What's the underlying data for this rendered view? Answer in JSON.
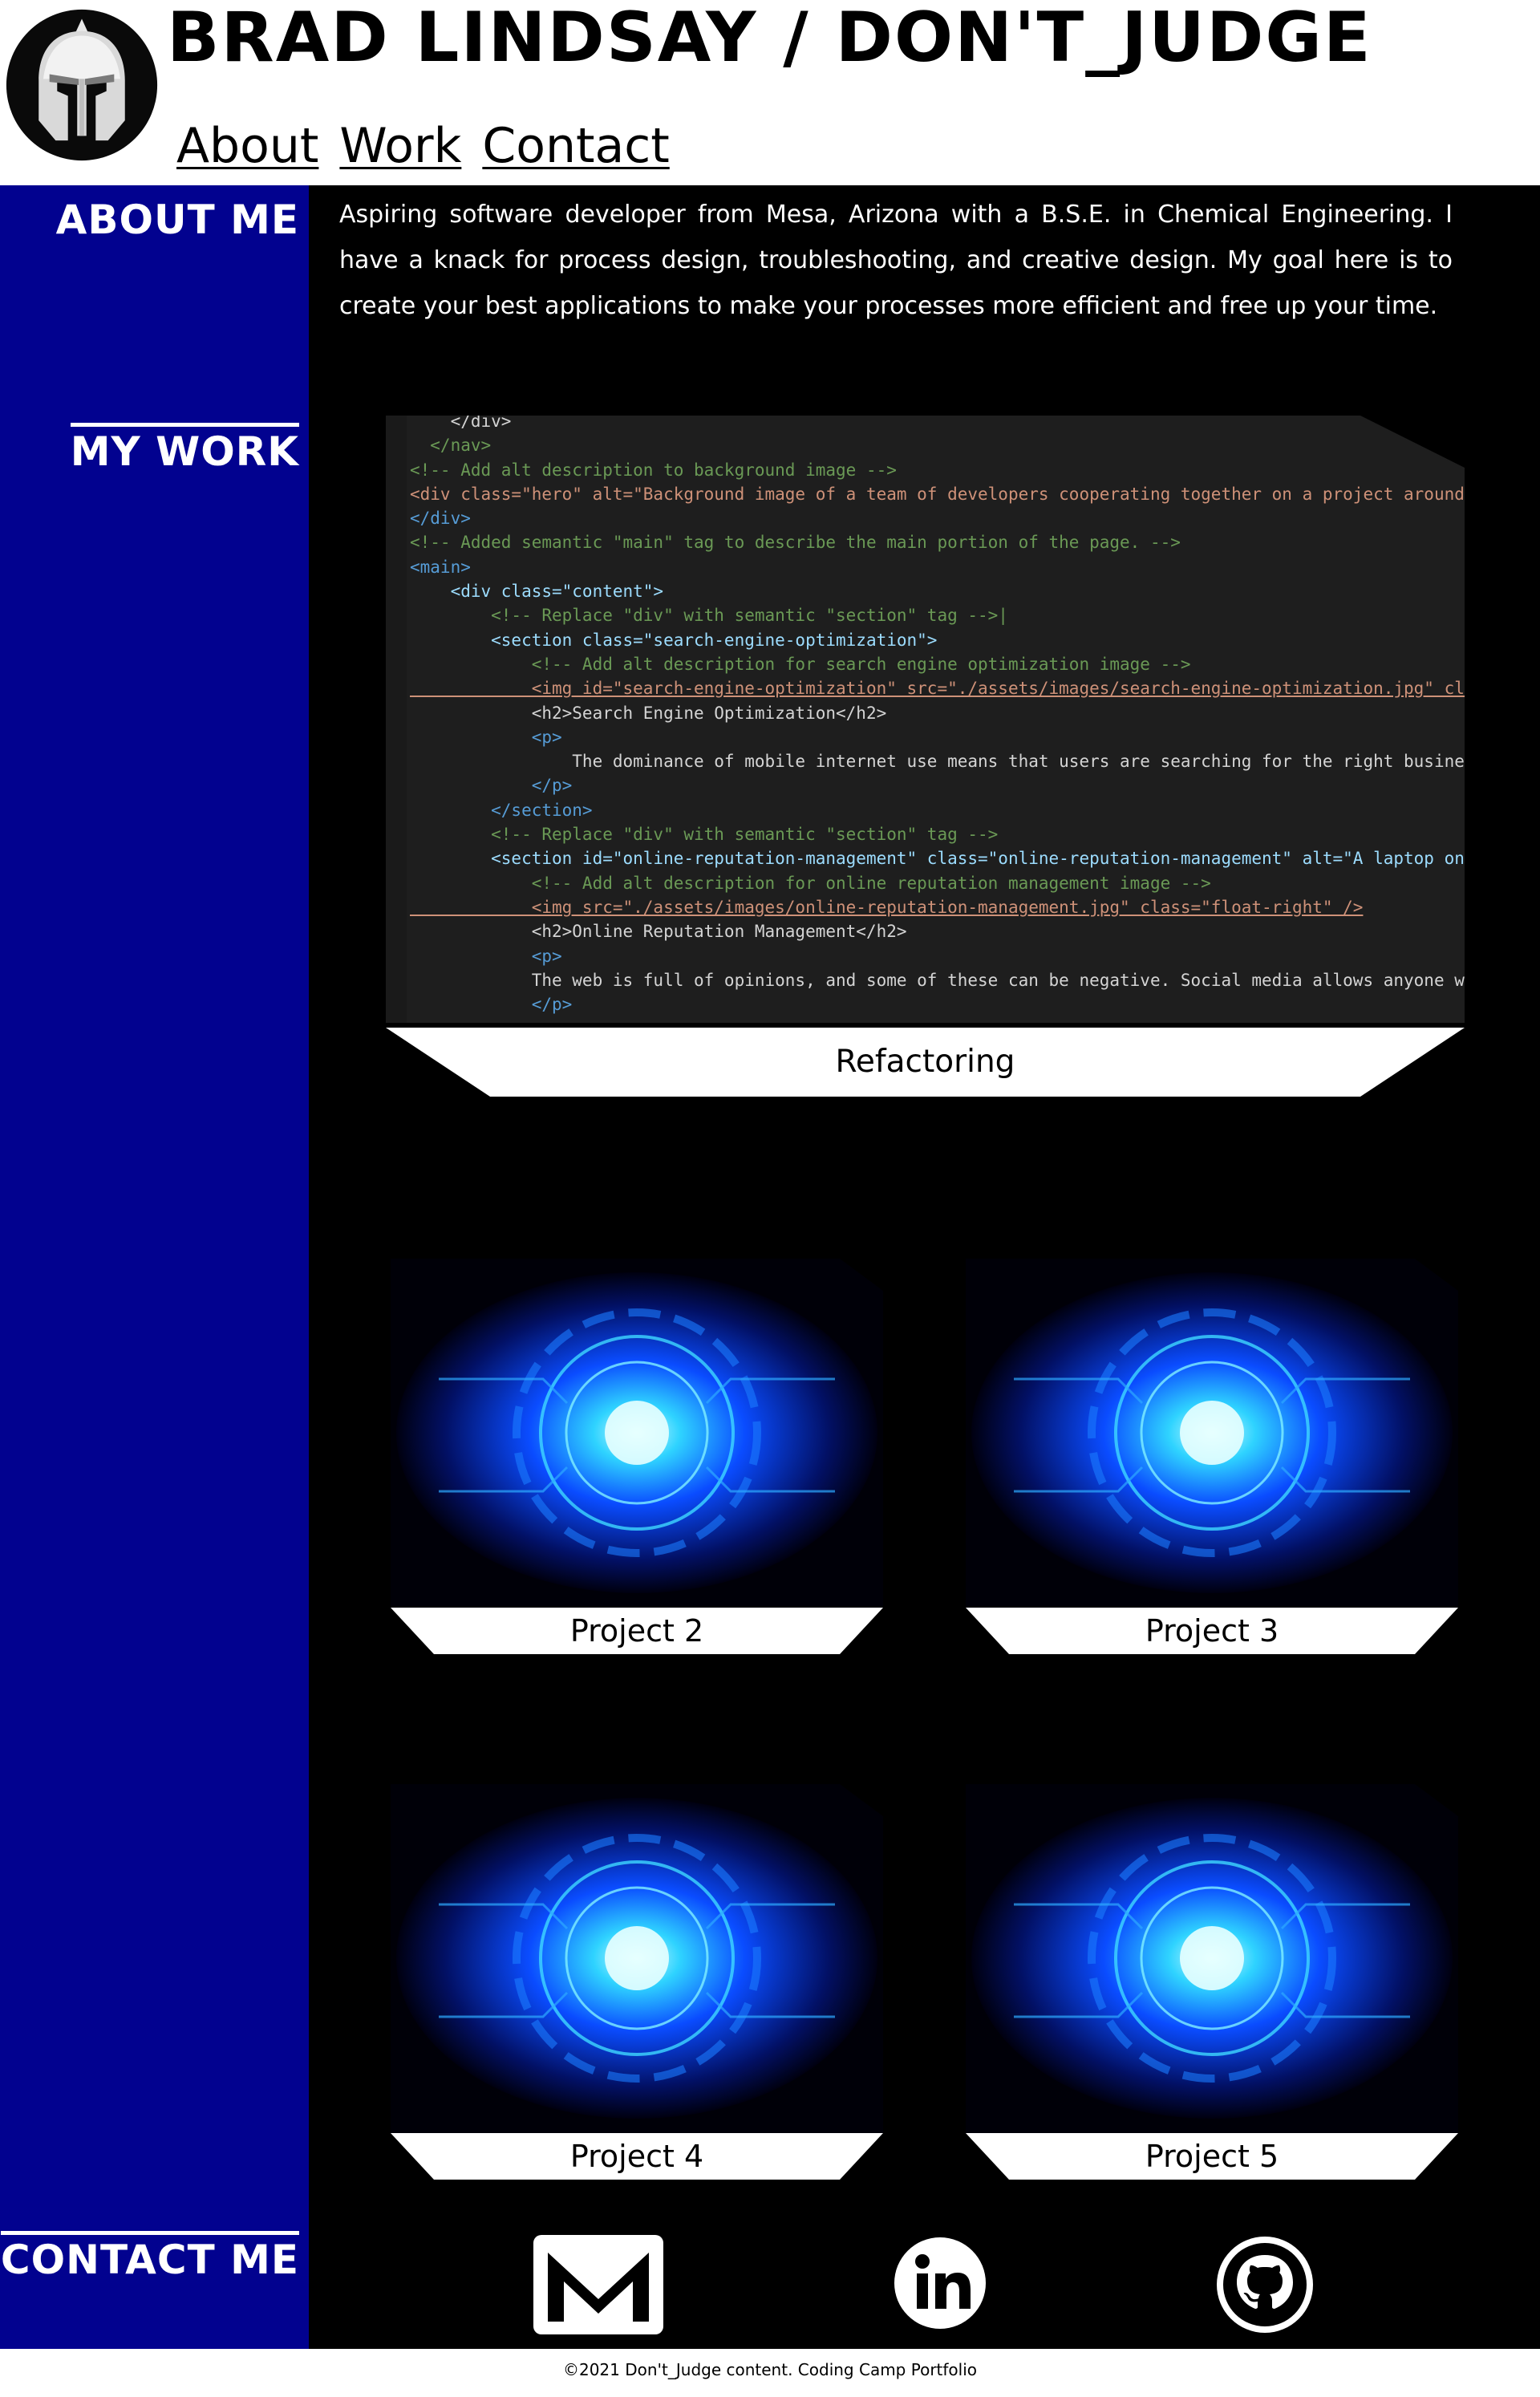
{
  "header": {
    "title": "BRAD LINDSAY / DON'T_JUDGE",
    "logo_icon": "spartan-helmet-icon",
    "nav": [
      {
        "label": "About"
      },
      {
        "label": "Work"
      },
      {
        "label": "Contact"
      }
    ]
  },
  "sections": {
    "about_heading": "ABOUT ME",
    "work_heading": "MY WORK",
    "contact_heading": "CONTACT ME"
  },
  "about": {
    "text": "Aspiring software developer from Mesa, Arizona with a B.S.E. in Chemical Engineering. I have a knack for process design, troubleshooting, and creative design. My goal here is to create your best applications to make your processes more efficient and free up your time."
  },
  "featured_project": {
    "title": "Refactoring",
    "screenshot_code": [
      "    </div>",
      "  </nav>",
      "<!-- Add alt description to background image -->",
      "<div class=\"hero\" alt=\"Background image of a team of developers cooperating together on a project around a",
      "</div>",
      "<!-- Added semantic \"main\" tag to describe the main portion of the page. -->",
      "<main>",
      "    <div class=\"content\">",
      "        <!-- Replace \"div\" with semantic \"section\" tag -->|",
      "        <section class=\"search-engine-optimization\">",
      "            <!-- Add alt description for search engine optimization image -->",
      "            <img id=\"search-engine-optimization\" src=\"./assets/images/search-engine-optimization.jpg\" class",
      "            <h2>Search Engine Optimization</h2>",
      "            <p>",
      "                The dominance of mobile internet use means that users are searching for the right business",
      "            </p>",
      "        </section>",
      "        <!-- Replace \"div\" with semantic \"section\" tag -->",
      "        <section id=\"online-reputation-management\" class=\"online-reputation-management\" alt=\"A laptop on a",
      "            <!-- Add alt description for online reputation management image -->",
      "            <img src=\"./assets/images/online-reputation-management.jpg\" class=\"float-right\" />",
      "            <h2>Online Reputation Management</h2>",
      "            <p>",
      "            The web is full of opinions, and some of these can be negative. Social media allows anyone with",
      "            </p>"
    ]
  },
  "projects": [
    {
      "title": "Project 2",
      "image_icon": "circuit-eye-image"
    },
    {
      "title": "Project 3",
      "image_icon": "circuit-eye-image"
    },
    {
      "title": "Project 4",
      "image_icon": "circuit-eye-image"
    },
    {
      "title": "Project 5",
      "image_icon": "circuit-eye-image"
    }
  ],
  "contact": [
    {
      "icon": "mail-icon"
    },
    {
      "icon": "linkedin-icon"
    },
    {
      "icon": "github-icon"
    }
  ],
  "footer": {
    "text": "©2021 Don't_Judge content. Coding Camp Portfolio"
  },
  "colors": {
    "sidebar": "#02028f",
    "main_bg": "#000000",
    "caption_bg": "#ffffff",
    "code_bg": "#1e1e1e"
  }
}
